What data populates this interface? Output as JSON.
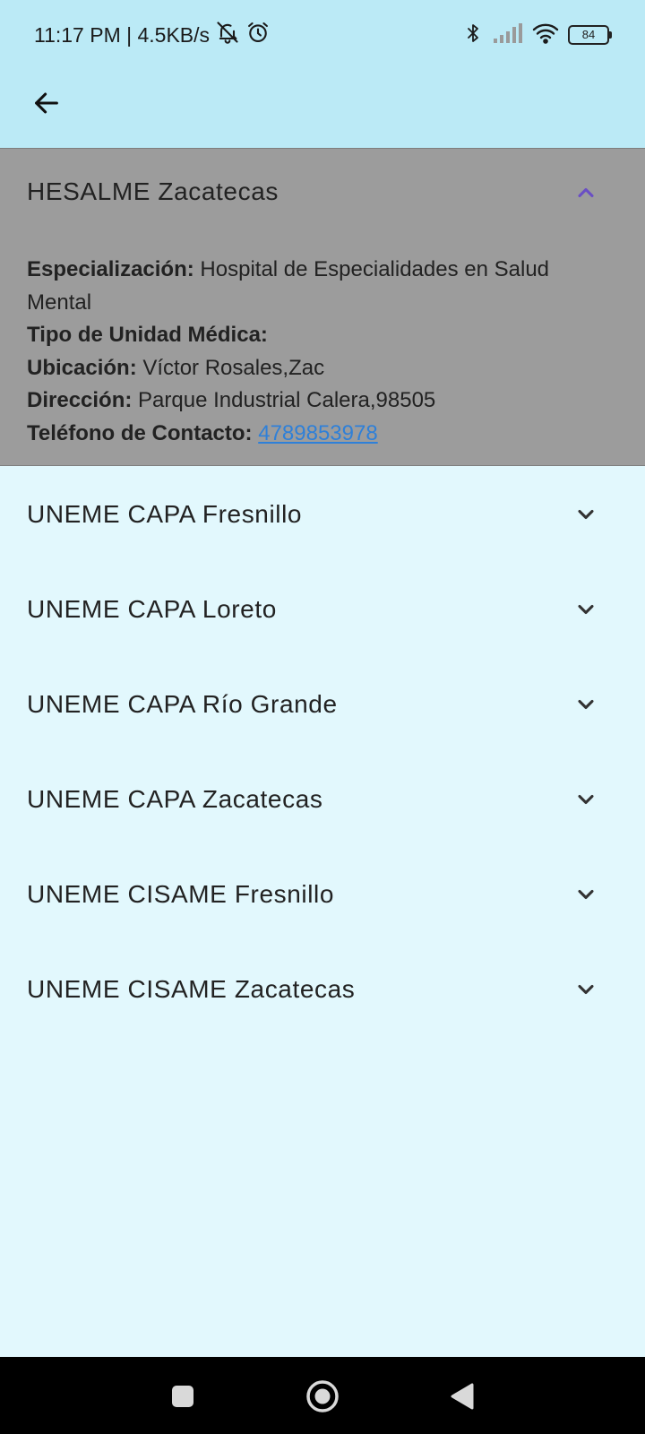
{
  "status_bar": {
    "time_speed": "11:17 PM | 4.5KB/s",
    "battery": "84",
    "icons": [
      "mute-icon",
      "alarm-icon",
      "bluetooth-icon",
      "signal-icon",
      "wifi-icon",
      "battery-icon"
    ]
  },
  "app_bar": {
    "back_icon": "arrow-left-icon"
  },
  "expanded_item": {
    "title": "HESALME Zacatecas",
    "fields": [
      {
        "label": "Especialización:",
        "value": "Hospital de Especialidades en Salud Mental"
      },
      {
        "label": "Tipo de Unidad Médica:",
        "value": ""
      },
      {
        "label": "Ubicación:",
        "value": "Víctor Rosales,Zac"
      },
      {
        "label": "Dirección:",
        "value": "Parque Industrial Calera,98505"
      },
      {
        "label": "Teléfono de Contacto:",
        "value": "4789853978"
      }
    ]
  },
  "list_items": [
    {
      "title": "UNEME CAPA Fresnillo"
    },
    {
      "title": "UNEME CAPA Loreto"
    },
    {
      "title": "UNEME CAPA Río Grande"
    },
    {
      "title": "UNEME CAPA Zacatecas"
    },
    {
      "title": "UNEME CISAME Fresnillo"
    },
    {
      "title": "UNEME CISAME Zacatecas"
    }
  ],
  "colors": {
    "app_bar": "#bbeaf6",
    "background": "#e2f8fd",
    "expanded_background": "#9c9c9c",
    "expanded_chevron": "#6a4fc4",
    "link": "#2f80d8"
  },
  "nav_bar": {
    "icons": [
      "recent-apps-icon",
      "home-icon",
      "back-icon"
    ]
  }
}
